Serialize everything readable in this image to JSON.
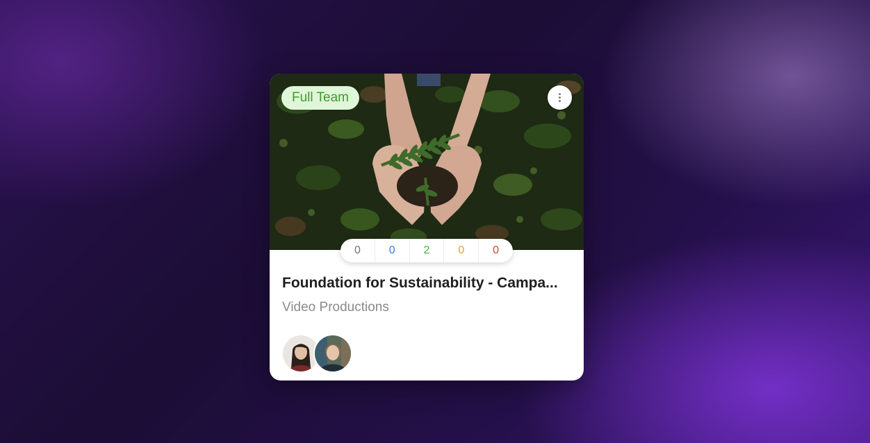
{
  "card": {
    "badge_label": "Full Team",
    "image_subject": "hands holding a fern seedling over leaves",
    "stats": [
      {
        "value": "0",
        "color": "#747474"
      },
      {
        "value": "0",
        "color": "#3b7bd6"
      },
      {
        "value": "2",
        "color": "#45b33c"
      },
      {
        "value": "0",
        "color": "#e5a233"
      },
      {
        "value": "0",
        "color": "#c9483b"
      }
    ],
    "title": "Foundation for Sustainability - Campa...",
    "subtitle": "Video Productions",
    "menu_icon": "more-vertical-icon",
    "avatars": [
      "team-member-avatar-1",
      "team-member-avatar-2"
    ]
  },
  "colors": {
    "badge_bg": "#dff6d8",
    "badge_text": "#3f9a2d",
    "card_bg": "#ffffff",
    "background_accent": "#7e34d6"
  }
}
